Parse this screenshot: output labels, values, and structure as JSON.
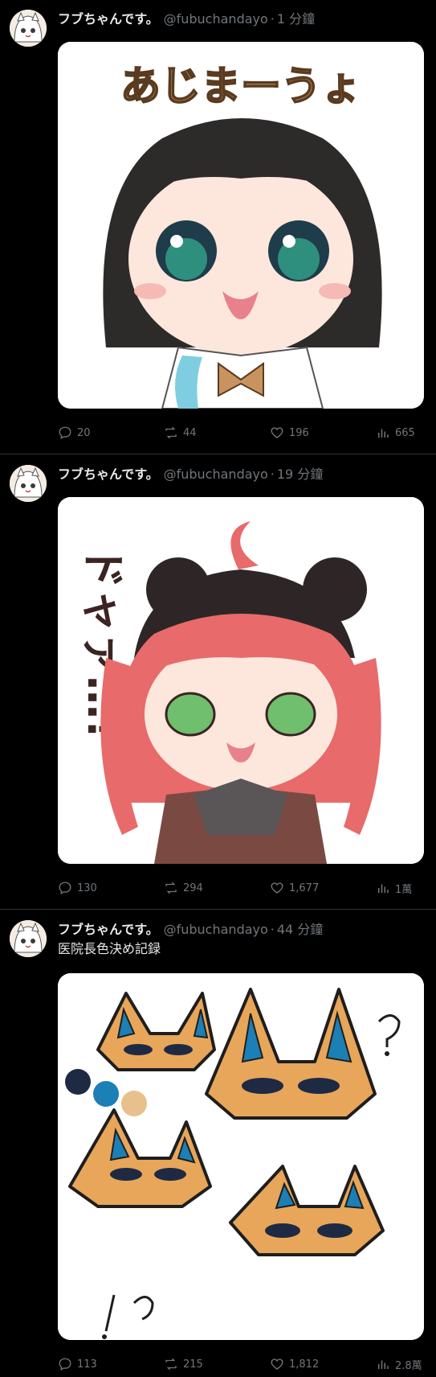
{
  "tweets": [
    {
      "author": "フブちゃんです。",
      "handle": "@fubuchandayo",
      "separator": "·",
      "time": "1 分鐘",
      "text": "",
      "image_caption": "あじまーうょ",
      "metrics": {
        "replies": "20",
        "retweets": "44",
        "likes": "196",
        "views": "665"
      }
    },
    {
      "author": "フブちゃんです。",
      "handle": "@fubuchandayo",
      "separator": "·",
      "time": "19 分鐘",
      "text": "",
      "image_caption": "ドャァ…!",
      "metrics": {
        "replies": "130",
        "retweets": "294",
        "likes": "1,677",
        "views": "1萬"
      }
    },
    {
      "author": "フブちゃんです。",
      "handle": "@fubuchandayo",
      "separator": "·",
      "time": "44 分鐘",
      "text": "医院長色決め記録",
      "image_caption": "",
      "metrics": {
        "replies": "113",
        "retweets": "215",
        "likes": "1,812",
        "views": "2.8萬"
      }
    }
  ],
  "colors": {
    "background": "#000000",
    "muted": "#71767b",
    "text": "#e7e9ea",
    "divider": "#2f3336"
  }
}
